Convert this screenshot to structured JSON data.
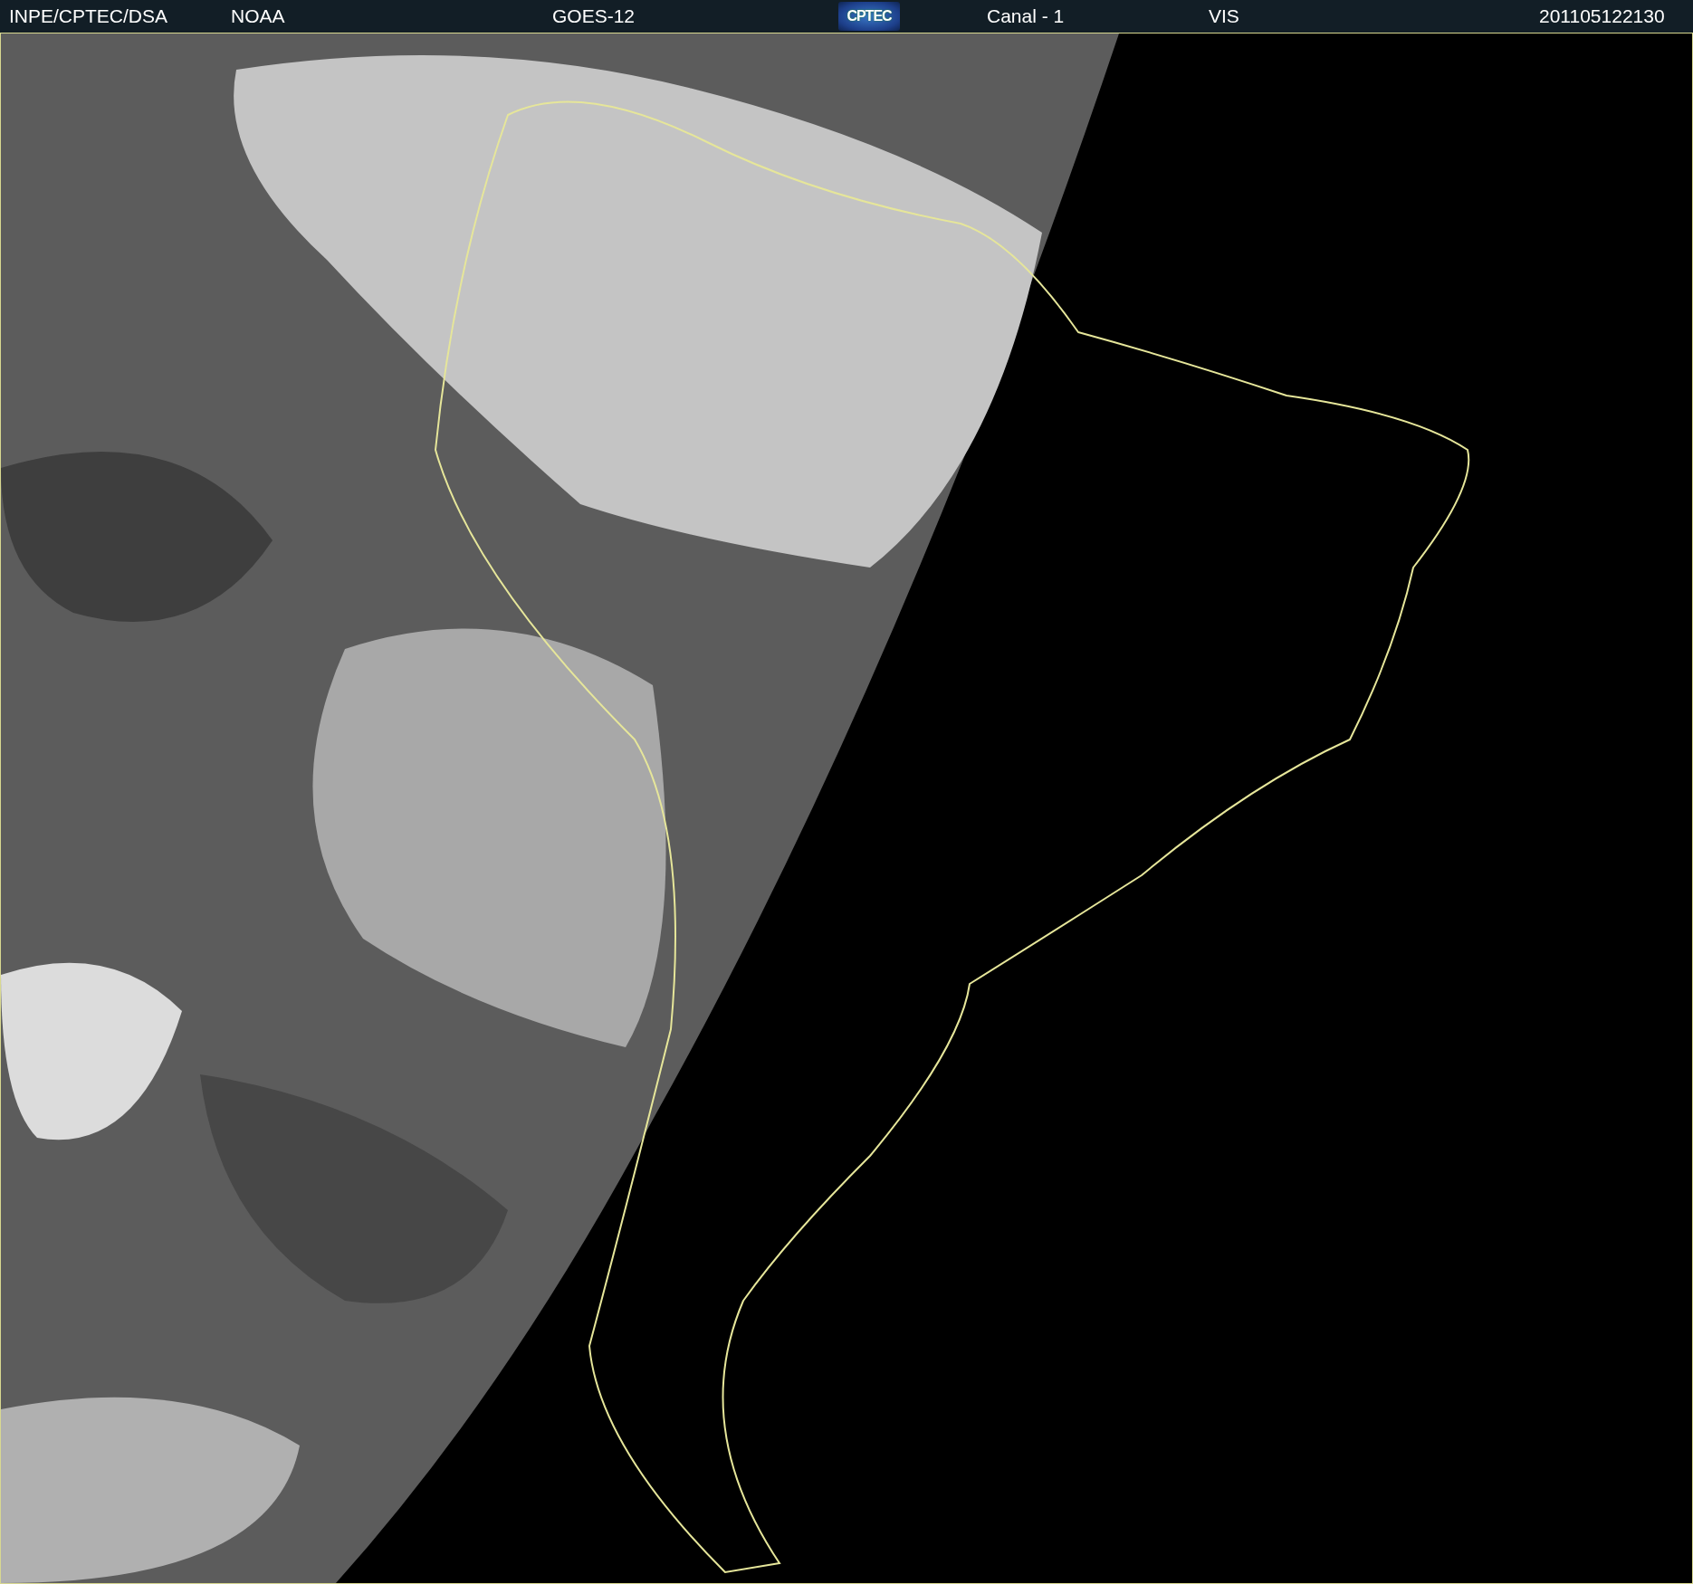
{
  "header": {
    "source": "INPE/CPTEC/DSA",
    "agency": "NOAA",
    "satellite": "GOES-12",
    "logo": "CPTEC",
    "channel": "Canal - 1",
    "band": "VIS",
    "timestamp": "201105122130"
  }
}
